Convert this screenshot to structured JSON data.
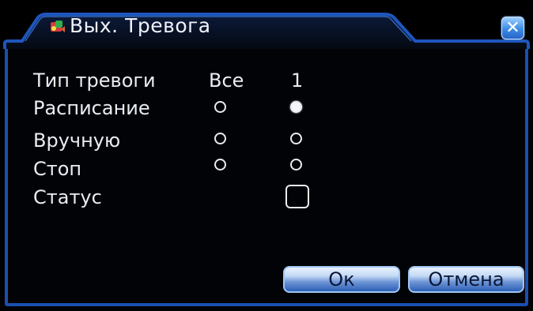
{
  "window": {
    "title": "Вых. Тревога",
    "close_label": "✕",
    "accent_color": "#1b4fb0"
  },
  "form": {
    "header": {
      "type_label": "Тип тревоги",
      "col_all": "Все",
      "col_1": "1"
    },
    "rows": [
      {
        "label": "Расписание",
        "all_selected": false,
        "ch1_selected": true
      },
      {
        "label": "Вручную",
        "all_selected": false,
        "ch1_selected": false
      },
      {
        "label": "Стоп",
        "all_selected": false,
        "ch1_selected": false
      }
    ],
    "status": {
      "label": "Статус",
      "checked": false
    }
  },
  "buttons": {
    "ok_label": "Ок",
    "cancel_label": "Отмена"
  },
  "icons": {
    "title_icon": "alarm-output-icon",
    "close_icon": "close-icon"
  }
}
